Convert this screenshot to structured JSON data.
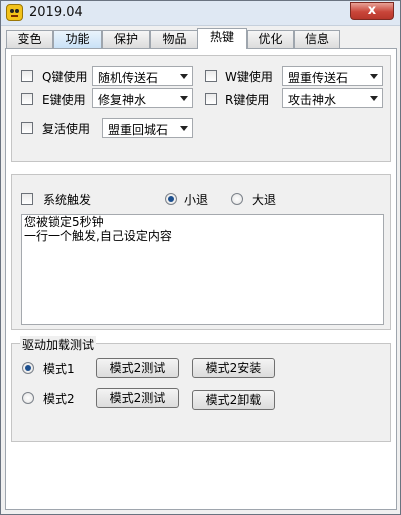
{
  "window": {
    "title": "2019.04",
    "close_glyph": "x",
    "icon": "app-face-icon"
  },
  "tabs": [
    {
      "label": "变色"
    },
    {
      "label": "功能"
    },
    {
      "label": "保护"
    },
    {
      "label": "物品"
    },
    {
      "label": "热键"
    },
    {
      "label": "优化"
    },
    {
      "label": "信息"
    }
  ],
  "active_tab": "热键",
  "hotkeys": {
    "q": {
      "label": "Q键使用",
      "value": "随机传送石",
      "checked": false
    },
    "w": {
      "label": "W键使用",
      "value": "盟重传送石",
      "checked": false
    },
    "e": {
      "label": "E键使用",
      "value": "修复神水",
      "checked": false
    },
    "r": {
      "label": "R键使用",
      "value": "攻击神水",
      "checked": false
    },
    "revive": {
      "label": "复活使用",
      "value": "盟重回城石",
      "checked": false
    }
  },
  "trigger": {
    "system_label": "系统触发",
    "system_checked": false,
    "small_exit_label": "小退",
    "big_exit_label": "大退",
    "selected": "小退",
    "text_lines": [
      "您被锁定5秒钟",
      "一行一个触发,自己设定内容"
    ]
  },
  "driver": {
    "title": "驱动加载测试",
    "mode1_label": "模式1",
    "mode2_label": "模式2",
    "selected": "模式1",
    "mode2_test_label": "模式2测试",
    "mode2_install_label": "模式2安装",
    "mode2_test_label_b": "模式2测试",
    "mode2_uninstall_label": "模式2卸载"
  }
}
